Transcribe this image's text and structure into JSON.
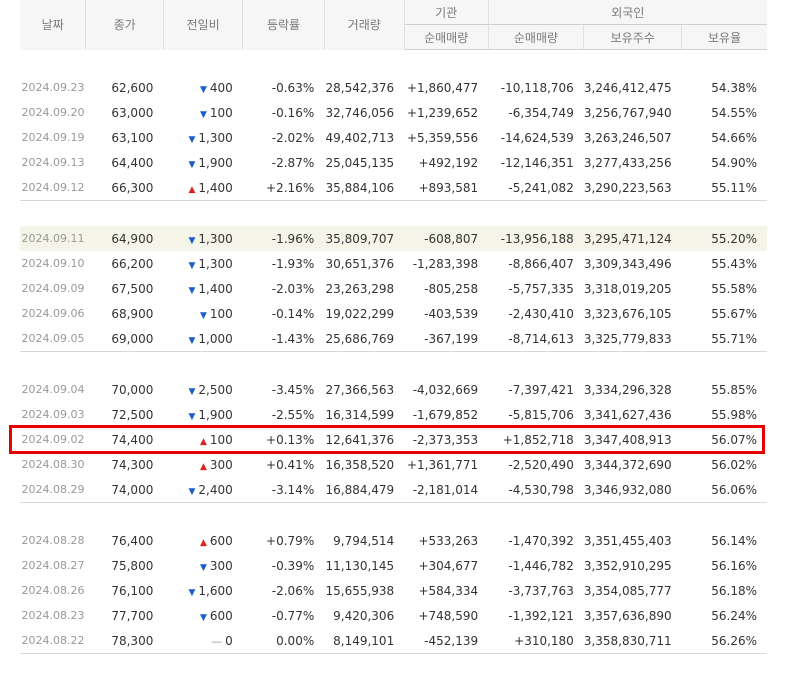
{
  "headers": {
    "date": "날짜",
    "close": "종가",
    "change": "전일비",
    "rate": "등락률",
    "volume": "거래량",
    "inst_group": "기관",
    "foreign_group": "외국인",
    "inst_net": "순매매량",
    "foreign_net": "순매매량",
    "foreign_shares": "보유주수",
    "foreign_ratio": "보유율"
  },
  "groups": [
    {
      "rows": [
        {
          "date": "2024.09.23",
          "close": "62,600",
          "dir": "dn",
          "change": "400",
          "rate": "-0.63%",
          "volume": "28,542,376",
          "inst": "+1,860,477",
          "foreign": "-10,118,706",
          "shares": "3,246,412,475",
          "ratio": "54.38%"
        },
        {
          "date": "2024.09.20",
          "close": "63,000",
          "dir": "dn",
          "change": "100",
          "rate": "-0.16%",
          "volume": "32,746,056",
          "inst": "+1,239,652",
          "foreign": "-6,354,749",
          "shares": "3,256,767,940",
          "ratio": "54.55%"
        },
        {
          "date": "2024.09.19",
          "close": "63,100",
          "dir": "dn",
          "change": "1,300",
          "rate": "-2.02%",
          "volume": "49,402,713",
          "inst": "+5,359,556",
          "foreign": "-14,624,539",
          "shares": "3,263,246,507",
          "ratio": "54.66%"
        },
        {
          "date": "2024.09.13",
          "close": "64,400",
          "dir": "dn",
          "change": "1,900",
          "rate": "-2.87%",
          "volume": "25,045,135",
          "inst": "+492,192",
          "foreign": "-12,146,351",
          "shares": "3,277,433,256",
          "ratio": "54.90%"
        },
        {
          "date": "2024.09.12",
          "close": "66,300",
          "dir": "up",
          "change": "1,400",
          "rate": "+2.16%",
          "volume": "35,884,106",
          "inst": "+893,581",
          "foreign": "-5,241,082",
          "shares": "3,290,223,563",
          "ratio": "55.11%"
        }
      ]
    },
    {
      "rows": [
        {
          "date": "2024.09.11",
          "close": "64,900",
          "dir": "dn",
          "change": "1,300",
          "rate": "-1.96%",
          "volume": "35,809,707",
          "inst": "-608,807",
          "foreign": "-13,956,188",
          "shares": "3,295,471,124",
          "ratio": "55.20%",
          "hover": true
        },
        {
          "date": "2024.09.10",
          "close": "66,200",
          "dir": "dn",
          "change": "1,300",
          "rate": "-1.93%",
          "volume": "30,651,376",
          "inst": "-1,283,398",
          "foreign": "-8,866,407",
          "shares": "3,309,343,496",
          "ratio": "55.43%"
        },
        {
          "date": "2024.09.09",
          "close": "67,500",
          "dir": "dn",
          "change": "1,400",
          "rate": "-2.03%",
          "volume": "23,263,298",
          "inst": "-805,258",
          "foreign": "-5,757,335",
          "shares": "3,318,019,205",
          "ratio": "55.58%"
        },
        {
          "date": "2024.09.06",
          "close": "68,900",
          "dir": "dn",
          "change": "100",
          "rate": "-0.14%",
          "volume": "19,022,299",
          "inst": "-403,539",
          "foreign": "-2,430,410",
          "shares": "3,323,676,105",
          "ratio": "55.67%"
        },
        {
          "date": "2024.09.05",
          "close": "69,000",
          "dir": "dn",
          "change": "1,000",
          "rate": "-1.43%",
          "volume": "25,686,769",
          "inst": "-367,199",
          "foreign": "-8,714,613",
          "shares": "3,325,779,833",
          "ratio": "55.71%"
        }
      ]
    },
    {
      "rows": [
        {
          "date": "2024.09.04",
          "close": "70,000",
          "dir": "dn",
          "change": "2,500",
          "rate": "-3.45%",
          "volume": "27,366,563",
          "inst": "-4,032,669",
          "foreign": "-7,397,421",
          "shares": "3,334,296,328",
          "ratio": "55.85%"
        },
        {
          "date": "2024.09.03",
          "close": "72,500",
          "dir": "dn",
          "change": "1,900",
          "rate": "-2.55%",
          "volume": "16,314,599",
          "inst": "-1,679,852",
          "foreign": "-5,815,706",
          "shares": "3,341,627,436",
          "ratio": "55.98%"
        },
        {
          "date": "2024.09.02",
          "close": "74,400",
          "dir": "up",
          "change": "100",
          "rate": "+0.13%",
          "volume": "12,641,376",
          "inst": "-2,373,353",
          "foreign": "+1,852,718",
          "shares": "3,347,408,913",
          "ratio": "56.07%",
          "marked": true
        },
        {
          "date": "2024.08.30",
          "close": "74,300",
          "dir": "up",
          "change": "300",
          "rate": "+0.41%",
          "volume": "16,358,520",
          "inst": "+1,361,771",
          "foreign": "-2,520,490",
          "shares": "3,344,372,690",
          "ratio": "56.02%"
        },
        {
          "date": "2024.08.29",
          "close": "74,000",
          "dir": "dn",
          "change": "2,400",
          "rate": "-3.14%",
          "volume": "16,884,479",
          "inst": "-2,181,014",
          "foreign": "-4,530,798",
          "shares": "3,346,932,080",
          "ratio": "56.06%"
        }
      ]
    },
    {
      "rows": [
        {
          "date": "2024.08.28",
          "close": "76,400",
          "dir": "up",
          "change": "600",
          "rate": "+0.79%",
          "volume": "9,794,514",
          "inst": "+533,263",
          "foreign": "-1,470,392",
          "shares": "3,351,455,403",
          "ratio": "56.14%"
        },
        {
          "date": "2024.08.27",
          "close": "75,800",
          "dir": "dn",
          "change": "300",
          "rate": "-0.39%",
          "volume": "11,130,145",
          "inst": "+304,677",
          "foreign": "-1,446,782",
          "shares": "3,352,910,295",
          "ratio": "56.16%"
        },
        {
          "date": "2024.08.26",
          "close": "76,100",
          "dir": "dn",
          "change": "1,600",
          "rate": "-2.06%",
          "volume": "15,655,938",
          "inst": "+584,334",
          "foreign": "-3,737,763",
          "shares": "3,354,085,777",
          "ratio": "56.18%"
        },
        {
          "date": "2024.08.23",
          "close": "77,700",
          "dir": "dn",
          "change": "600",
          "rate": "-0.77%",
          "volume": "9,420,306",
          "inst": "+748,590",
          "foreign": "-1,392,121",
          "shares": "3,357,636,890",
          "ratio": "56.24%"
        },
        {
          "date": "2024.08.22",
          "close": "78,300",
          "dir": "ne",
          "change": "0",
          "rate": "0.00%",
          "volume": "8,149,101",
          "inst": "-452,139",
          "foreign": "+310,180",
          "shares": "3,358,830,711",
          "ratio": "56.26%"
        }
      ]
    }
  ],
  "colors": {
    "up": "#d60000",
    "down": "#1a5ec8",
    "highlight_box": "#e60000",
    "hover_row": "#f4f4e8"
  }
}
